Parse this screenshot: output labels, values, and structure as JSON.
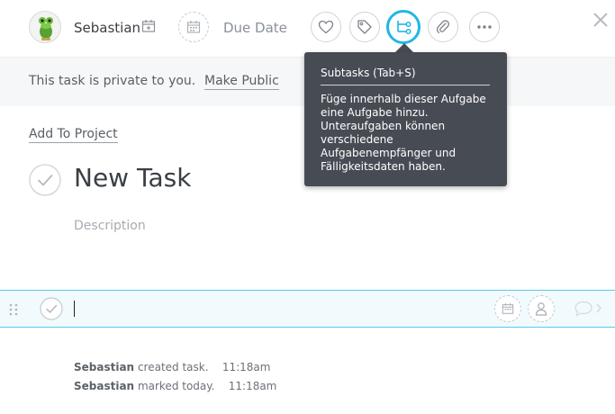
{
  "header": {
    "assignee_name": "Sebastian",
    "due_date_label": "Due Date"
  },
  "banner": {
    "private_text": "This task is private to you.",
    "make_public": "Make Public"
  },
  "task": {
    "add_to_project": "Add To Project",
    "title": "New Task",
    "description_placeholder": "Description"
  },
  "tooltip": {
    "title": "Subtasks (Tab+S)",
    "body": "Füge innerhalb dieser Aufgabe eine Aufgabe hinzu. Unteraufgaben können verschiedene Aufgabenempfänger und Fälligkeitsdaten haben."
  },
  "activity": [
    {
      "user": "Sebastian",
      "action": "created task.",
      "time": "11:18am"
    },
    {
      "user": "Sebastian",
      "action": "marked today.",
      "time": "11:18am"
    }
  ],
  "colors": {
    "accent": "#1fb6e6",
    "tooltip_bg": "#474b53",
    "banner_bg": "#f6f7f8",
    "subtask_row_bg": "#f1fbfe"
  },
  "icons": [
    "frog-avatar",
    "calendar-icon",
    "heart-icon",
    "tag-icon",
    "subtasks-icon",
    "paperclip-icon",
    "more-icon",
    "close-icon",
    "check-icon",
    "drag-handle-icon",
    "user-icon",
    "comment-icon"
  ]
}
